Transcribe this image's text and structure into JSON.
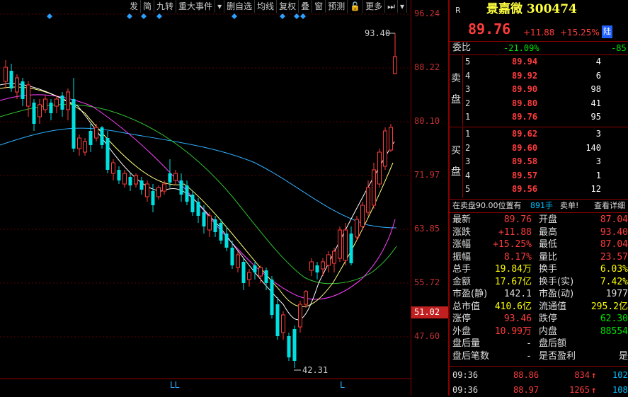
{
  "toolbar": {
    "items": [
      "发",
      "简",
      "九转",
      "重大事件",
      "▾",
      "删自选",
      "均线",
      "复权",
      "叠",
      "窗",
      "预测",
      "🔓",
      "更多",
      "⏭",
      "▾"
    ]
  },
  "price_axis": {
    "labels": [
      "96.24",
      "88.22",
      "80.10",
      "71.97",
      "63.85",
      "55.72",
      "47.60"
    ],
    "current": "51.02"
  },
  "chart_annotations": {
    "high": "93.40",
    "low": "42.31",
    "ll_marker": "LL",
    "l_marker": "L"
  },
  "stock": {
    "badge": "R",
    "name": "景嘉微 300474",
    "price": "89.76",
    "change": "+11.88",
    "change_pct": "+15.25%",
    "exchange_badge": "陆"
  },
  "weibi": {
    "label": "委比",
    "value": "-21.09%",
    "diff": "-85"
  },
  "sell_side_label": [
    "卖",
    "盘"
  ],
  "buy_side_label": [
    "买",
    "盘"
  ],
  "sell_orders": [
    {
      "level": "5",
      "price": "89.94",
      "vol": "4"
    },
    {
      "level": "4",
      "price": "89.92",
      "vol": "6"
    },
    {
      "level": "3",
      "price": "89.90",
      "vol": "98"
    },
    {
      "level": "2",
      "price": "89.80",
      "vol": "41"
    },
    {
      "level": "1",
      "price": "89.76",
      "vol": "95"
    }
  ],
  "buy_orders": [
    {
      "level": "1",
      "price": "89.62",
      "vol": "3"
    },
    {
      "level": "2",
      "price": "89.60",
      "vol": "140"
    },
    {
      "level": "3",
      "price": "89.58",
      "vol": "3"
    },
    {
      "level": "4",
      "price": "89.57",
      "vol": "1"
    },
    {
      "level": "5",
      "price": "89.56",
      "vol": "12"
    }
  ],
  "position_bar": {
    "text": "在卖盘90.00位置有",
    "hands": "891手",
    "sell_tag": "卖单!",
    "link": "查看详细"
  },
  "stats": [
    {
      "k": "最新",
      "v": "89.76",
      "c": "red",
      "k2": "开盘",
      "v2": "87.04",
      "c2": "red"
    },
    {
      "k": "涨跌",
      "v": "+11.88",
      "c": "red",
      "k2": "最高",
      "v2": "93.40",
      "c2": "red"
    },
    {
      "k": "涨幅",
      "v": "+15.25%",
      "c": "red",
      "k2": "最低",
      "v2": "87.04",
      "c2": "red"
    },
    {
      "k": "振幅",
      "v": "8.17%",
      "c": "red",
      "k2": "量比",
      "v2": "23.57",
      "c2": "red"
    },
    {
      "k": "总手",
      "v": "19.84万",
      "c": "yellow",
      "k2": "换手",
      "v2": "6.03%",
      "c2": "yellow"
    },
    {
      "k": "金额",
      "v": "17.67亿",
      "c": "yellow",
      "k2": "换手(实)",
      "v2": "7.42%",
      "c2": "yellow"
    },
    {
      "k": "市盈(静)",
      "v": "142.1",
      "c": "white",
      "k2": "市盈(动)",
      "v2": "1977",
      "c2": "white"
    },
    {
      "k": "总市值",
      "v": "410.6亿",
      "c": "yellow",
      "k2": "流通值",
      "v2": "295.2亿",
      "c2": "yellow"
    },
    {
      "k": "涨停",
      "v": "93.46",
      "c": "red",
      "k2": "跌停",
      "v2": "62.30",
      "c2": "green"
    },
    {
      "k": "外盘",
      "v": "10.99万",
      "c": "red",
      "k2": "内盘",
      "v2": "88554",
      "c2": "green"
    },
    {
      "k": "盘后量",
      "v": "-",
      "c": "white",
      "k2": "盘后额",
      "v2": "",
      "c2": "white"
    },
    {
      "k": "盘后笔数",
      "v": "-",
      "c": "white",
      "k2": "是否盈利",
      "v2": "是",
      "c2": "white"
    }
  ],
  "ticks": [
    {
      "time": "09:36",
      "price": "88.86",
      "vol": "834",
      "arrow": "↑",
      "extra": "102"
    },
    {
      "time": "09:36",
      "price": "88.97",
      "vol": "1265",
      "arrow": "↑",
      "extra": "108"
    }
  ]
}
